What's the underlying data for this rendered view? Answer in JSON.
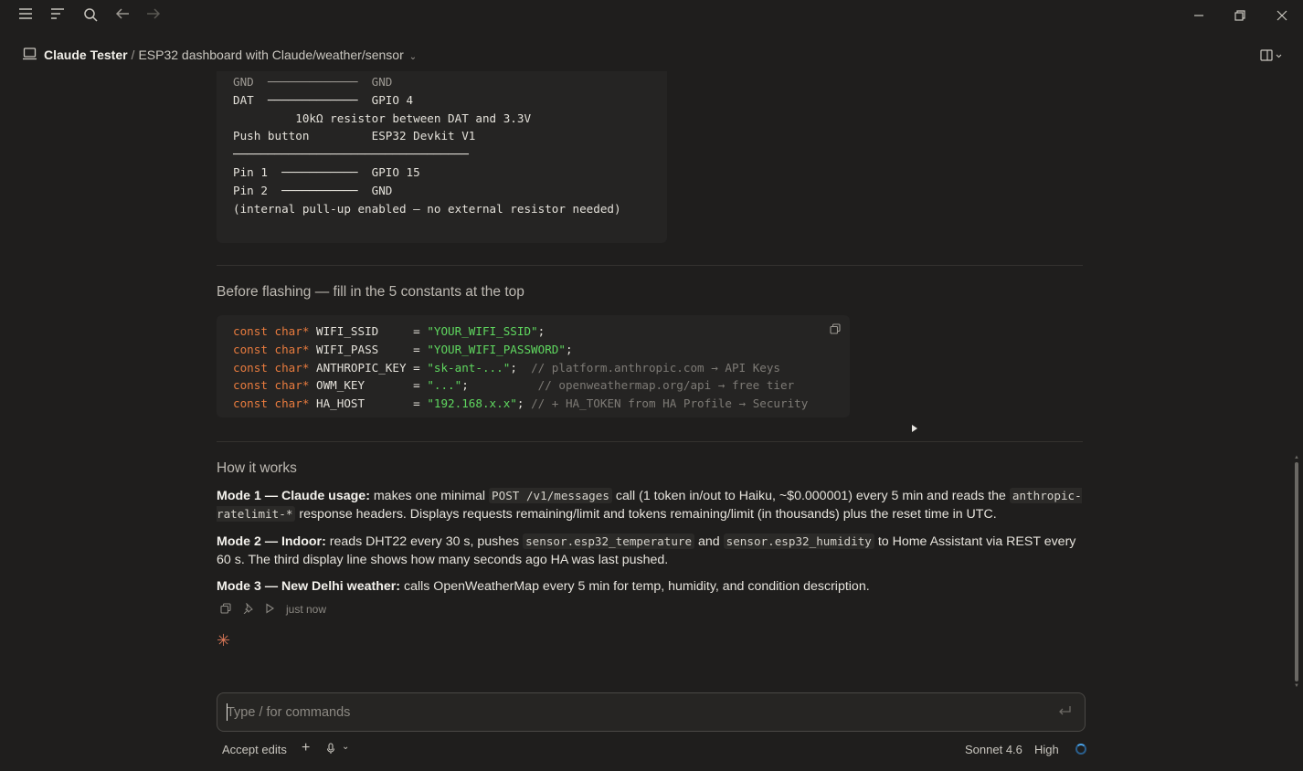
{
  "colors": {
    "background": "#1f1e1d",
    "code_bg": "#252423",
    "keyword": "#e87b3e",
    "string": "#5fd75f",
    "comment": "#7d7a75",
    "accent_spark": "#d97757",
    "spinner": "#4aa3e8"
  },
  "topbar": {
    "icons": [
      "menu-icon",
      "list-icon",
      "search-icon",
      "back-arrow-icon",
      "forward-arrow-icon"
    ],
    "window_controls": [
      "minimize-icon",
      "restore-icon",
      "close-icon"
    ]
  },
  "breadcrumb": {
    "project": "Claude Tester",
    "separator": "/",
    "chat": "ESP32 dashboard with Claude/weather/sensor",
    "chevron": "⌄"
  },
  "wiring_block": {
    "lines": [
      "GND  ─────────────  GND",
      "DAT  ─────────────  GPIO 4",
      "         10kΩ resistor between DAT and 3.3V",
      "",
      "Push button         ESP32 Devkit V1",
      "──────────────────────────────────",
      "Pin 1  ───────────  GPIO 15",
      "Pin 2  ───────────  GND",
      "(internal pull-up enabled — no external resistor needed)"
    ]
  },
  "section_flash": {
    "heading": "Before flashing — fill in the 5 constants at the top"
  },
  "constants_block": {
    "lines": [
      {
        "kw": "const char*",
        "name": " WIFI_SSID     = ",
        "str": "\"YOUR_WIFI_SSID\"",
        "rest": ";",
        "cm": ""
      },
      {
        "kw": "const char*",
        "name": " WIFI_PASS     = ",
        "str": "\"YOUR_WIFI_PASSWORD\"",
        "rest": ";",
        "cm": ""
      },
      {
        "kw": "const char*",
        "name": " ANTHROPIC_KEY = ",
        "str": "\"sk-ant-...\"",
        "rest": ";  ",
        "cm": "// platform.anthropic.com → API Keys"
      },
      {
        "kw": "const char*",
        "name": " OWM_KEY       = ",
        "str": "\"...\"",
        "rest": ";          ",
        "cm": "// openweathermap.org/api → free tier"
      },
      {
        "kw": "const char*",
        "name": " HA_HOST       = ",
        "str": "\"192.168.x.x\"",
        "rest": "; ",
        "cm": "// + HA_TOKEN from HA Profile → Security"
      }
    ]
  },
  "section_how": {
    "heading": "How it works"
  },
  "modes": {
    "m1": {
      "title": "Mode 1 — Claude usage:",
      "t1": " makes one minimal ",
      "c1": "POST /v1/messages",
      "t2": " call (1 token in/out to Haiku, ~$0.000001) every 5 min and reads the ",
      "c2": "anthropic-ratelimit-*",
      "t3": " response headers. Displays requests remaining/limit and tokens remaining/limit (in thousands) plus the reset time in UTC."
    },
    "m2": {
      "title": "Mode 2 — Indoor:",
      "t1": " reads DHT22 every 30 s, pushes ",
      "c1": "sensor.esp32_temperature",
      "t2": " and ",
      "c2": "sensor.esp32_humidity",
      "t3": " to Home Assistant via REST every 60 s. The third display line shows how many seconds ago HA was last pushed."
    },
    "m3": {
      "title": "Mode 3 — New Delhi weather:",
      "t1": " calls OpenWeatherMap every 5 min for temp, humidity, and condition description."
    }
  },
  "message_actions": {
    "timestamp": "just now"
  },
  "spark": "✳",
  "composer": {
    "placeholder": "Type / for commands",
    "value": ""
  },
  "bottombar": {
    "accept_edits": "Accept edits",
    "plus": "+",
    "mic_chevron": "⌄",
    "model": "Sonnet 4.6",
    "effort": "High"
  }
}
